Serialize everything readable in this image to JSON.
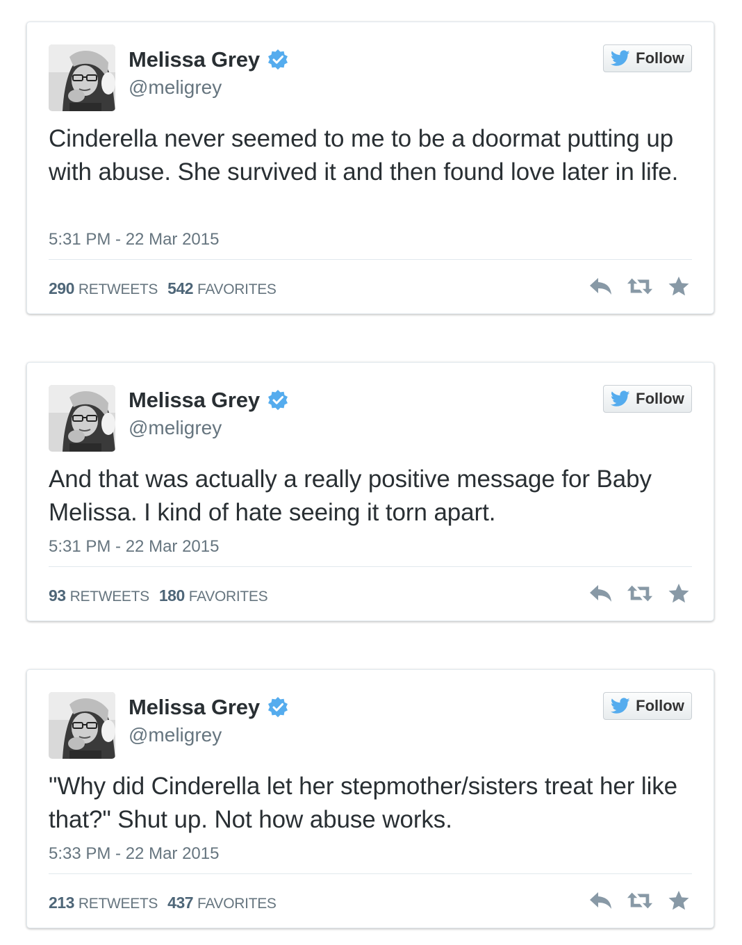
{
  "colors": {
    "text": "#292f33",
    "muted": "#66757f",
    "stat_number": "#4e6678",
    "verified_badge": "#55acee",
    "twitter_bird": "#55acee",
    "divider": "#e1e8ed"
  },
  "tweets": [
    {
      "user": {
        "name": "Melissa Grey",
        "handle": "@meligrey",
        "verified": true
      },
      "follow_label": "Follow",
      "text": "Cinderella never seemed to me to be a doormat putting up with abuse. She survived it and then found love later in life.",
      "timestamp": "5:31 PM - 22 Mar 2015",
      "retweets": "290",
      "retweets_label": "RETWEETS",
      "favorites": "542",
      "favorites_label": "FAVORITES",
      "action_icons": [
        "reply-icon",
        "retweet-icon",
        "favorite-star-icon"
      ]
    },
    {
      "user": {
        "name": "Melissa Grey",
        "handle": "@meligrey",
        "verified": true
      },
      "follow_label": "Follow",
      "text": "And that was actually a really positive message for Baby Melissa. I kind of hate seeing it torn apart.",
      "timestamp": "5:31 PM - 22 Mar 2015",
      "retweets": "93",
      "retweets_label": "RETWEETS",
      "favorites": "180",
      "favorites_label": "FAVORITES",
      "action_icons": [
        "reply-icon",
        "retweet-icon",
        "favorite-star-icon"
      ]
    },
    {
      "user": {
        "name": "Melissa Grey",
        "handle": "@meligrey",
        "verified": true
      },
      "follow_label": "Follow",
      "text": "\"Why did Cinderella let her stepmother/sisters treat her like that?\" Shut up. Not how abuse works.",
      "timestamp": "5:33 PM - 22 Mar 2015",
      "retweets": "213",
      "retweets_label": "RETWEETS",
      "favorites": "437",
      "favorites_label": "FAVORITES",
      "action_icons": [
        "reply-icon",
        "retweet-icon",
        "favorite-star-icon"
      ]
    }
  ]
}
